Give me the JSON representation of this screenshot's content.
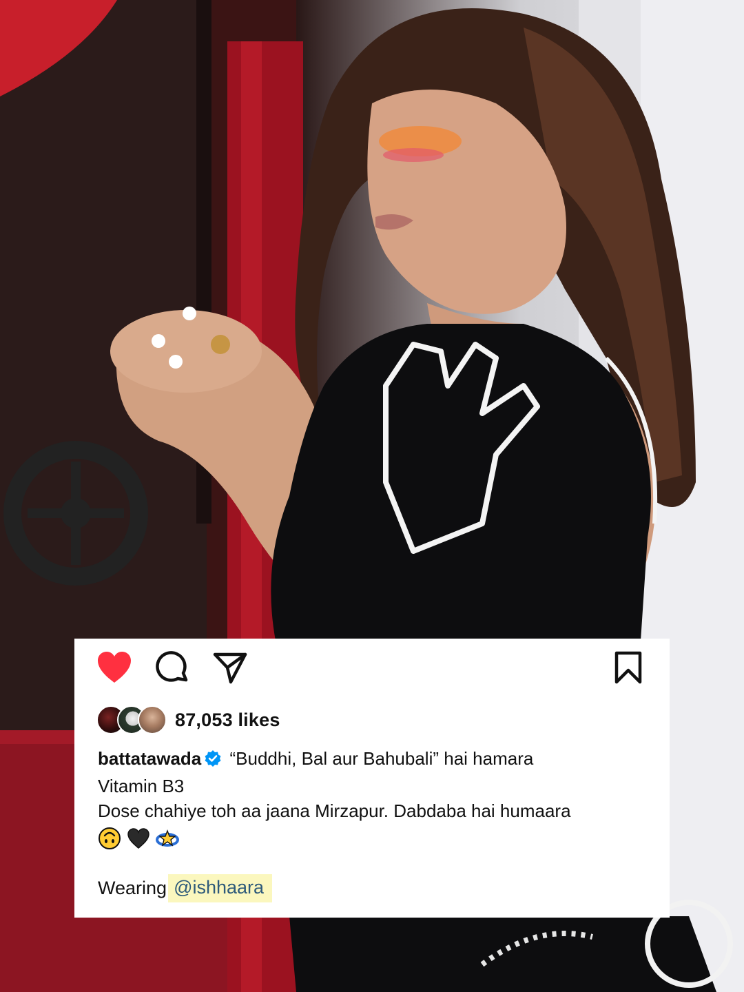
{
  "post": {
    "likes_text": "87,053 likes",
    "username": "battatawada",
    "caption_line1": "“Buddhi, Bal aur Bahubali” hai hamara",
    "caption_line2": "Vitamin B3",
    "caption_line3": "Dose chahiye toh aa jaana Mirzapur. Dabdaba hai humaara",
    "emojis": [
      "upside-down-face",
      "black-heart",
      "dizzy"
    ],
    "wearing_label": "Wearing",
    "mention": "@ishhaara"
  },
  "icons": {
    "like": "heart-filled-icon",
    "comment": "comment-icon",
    "share": "paper-plane-icon",
    "save": "bookmark-icon",
    "verified": "verified-badge-icon"
  },
  "colors": {
    "like_red": "#ff3040",
    "verified_blue": "#0095f6",
    "mention_highlight": "#fbf7be",
    "mention_text": "#2e5a7a"
  }
}
